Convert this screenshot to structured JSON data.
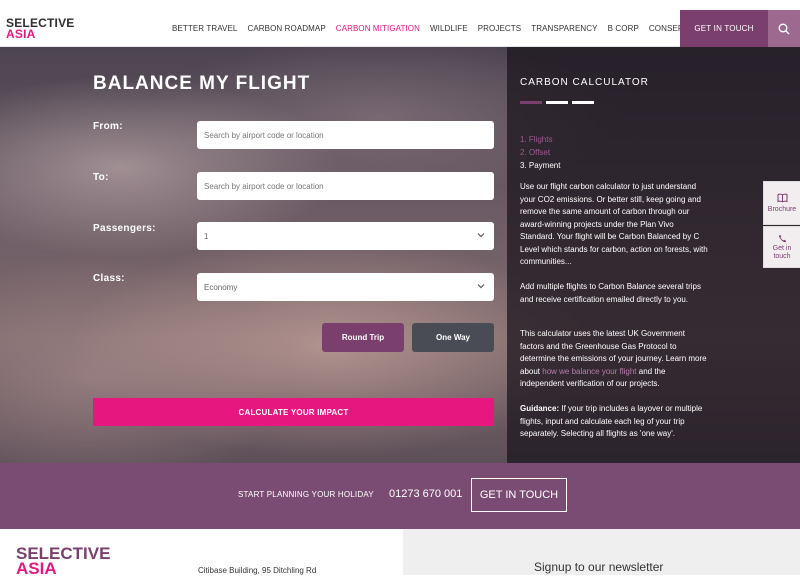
{
  "header": {
    "logo_line1": "SELECTIVE",
    "logo_line2": "ASIA",
    "nav": [
      "BETTER TRAVEL",
      "CARBON ROADMAP",
      "CARBON MITIGATION",
      "WILDLIFE",
      "PROJECTS",
      "TRANSPARENCY",
      "B CORP",
      "CONSERVATION"
    ],
    "active_nav": "CARBON MITIGATION",
    "get_in_touch": "GET IN TOUCH",
    "search_icon": "search-icon"
  },
  "form": {
    "title": "BALANCE MY FLIGHT",
    "from_label": "From:",
    "from_placeholder": "Search by airport code or location",
    "to_label": "To:",
    "to_placeholder": "Search by airport code or location",
    "passengers_label": "Passengers:",
    "passengers_value": "1",
    "class_label": "Class:",
    "class_value": "Economy",
    "round_trip": "Round Trip",
    "one_way": "One Way",
    "calculate": "CALCULATE YOUR IMPACT"
  },
  "calculator": {
    "title": "CARBON CALCULATOR",
    "steps": [
      "1. Flights",
      "2. Offset",
      "3. Payment"
    ],
    "p1": "Use our flight carbon calculator to just understand your CO2 emissions. Or better still, keep going and remove the same amount of carbon through our award-winning projects under the Plan Vivo Standard. Your flight will be Carbon Balanced by C Level which stands for carbon, action on forests, with communities...",
    "p2": "Add multiple flights to Carbon Balance several trips and receive certification emailed directly to you.",
    "p3_before": "This calculator uses the latest UK Government factors and the Greenhouse Gas Protocol to determine the emissions of your journey. Learn more about ",
    "p3_link": "how we balance your flight",
    "p3_after": " and the independent verification of our projects.",
    "guidance_label": "Guidance:",
    "guidance_text": " If your trip includes a layover or multiple flights, input and calculate each leg of your trip separately. Selecting all flights as 'one way'."
  },
  "side_tabs": {
    "brochure": "Brochure",
    "get_in_touch": "Get in touch"
  },
  "cta": {
    "text": "START PLANNING YOUR HOLIDAY",
    "phone": "01273 670 001",
    "button": "GET IN TOUCH"
  },
  "footer": {
    "logo_line1": "SELECTIVE",
    "logo_line2": "ASIA",
    "address": "Citibase Building, 95 Ditchling Rd",
    "newsletter": "Signup to our newsletter"
  },
  "colors": {
    "brand_purple": "#7b3f6d",
    "brand_pink": "#e6177f"
  }
}
